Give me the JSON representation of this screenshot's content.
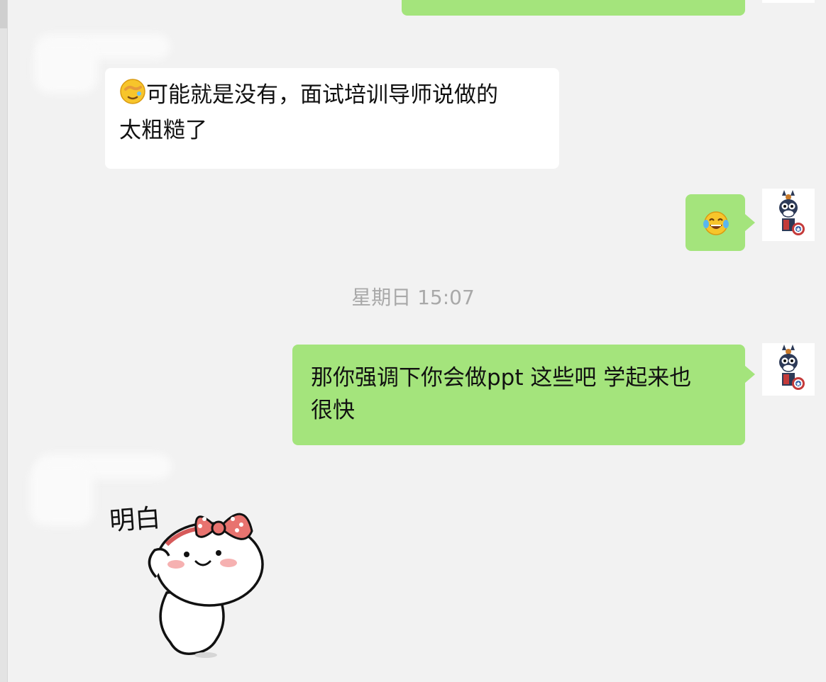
{
  "chat": {
    "messages": [
      {
        "from": "other",
        "icon": "facepalm-emoji-icon",
        "text_line1": "可能就是没有，面试培训导师说做的",
        "text_line2": "太粗糙了"
      },
      {
        "from": "me",
        "icon": "laughing-tears-emoji-icon"
      },
      {
        "from": "me",
        "text_line1": "那你强调下你会做ppt 这些吧 学起来也",
        "text_line2": "很快"
      },
      {
        "from": "other",
        "type": "sticker",
        "sticker_caption": "明白",
        "icon": "bow-girl-sticker-icon"
      }
    ],
    "timestamp": "星期日 15:07"
  },
  "colors": {
    "background": "#f2f2f2",
    "outgoing": "#a4e47c",
    "incoming": "#ffffff",
    "timestamp": "#a9a9a9"
  },
  "icons": {
    "my_avatar": "donkey-captain-avatar-icon",
    "other_avatar": "blurred-avatar"
  }
}
